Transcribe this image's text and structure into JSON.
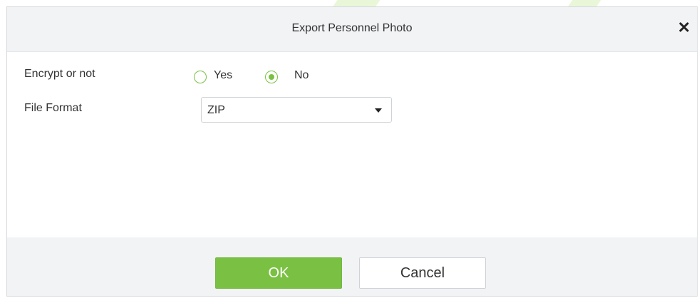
{
  "dialog": {
    "title": "Export Personnel Photo",
    "close_icon": "close-icon"
  },
  "form": {
    "encrypt": {
      "label": "Encrypt or not",
      "options": [
        {
          "label": "Yes",
          "selected": false
        },
        {
          "label": "No",
          "selected": true
        }
      ]
    },
    "file_format": {
      "label": "File Format",
      "value": "ZIP"
    }
  },
  "footer": {
    "ok_label": "OK",
    "cancel_label": "Cancel"
  },
  "colors": {
    "accent": "#7ac143",
    "header_bg": "#f1f3f5"
  }
}
